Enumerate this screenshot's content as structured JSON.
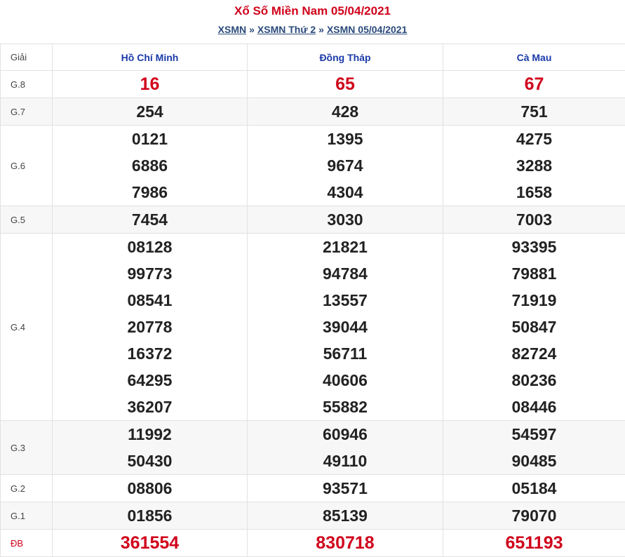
{
  "header": {
    "title": "Xổ Số Miền Nam 05/04/2021",
    "crumbs": [
      "XSMN",
      "XSMN Thứ 2",
      "XSMN 05/04/2021"
    ],
    "sep": "»"
  },
  "table": {
    "giai_header": "Giải",
    "provinces": [
      "Hồ Chí Minh",
      "Đồng Tháp",
      "Cà Mau"
    ],
    "rows": [
      {
        "label": "G.8",
        "red": true,
        "alt": false,
        "cols": [
          [
            "16"
          ],
          [
            "65"
          ],
          [
            "67"
          ]
        ]
      },
      {
        "label": "G.7",
        "red": false,
        "alt": true,
        "cols": [
          [
            "254"
          ],
          [
            "428"
          ],
          [
            "751"
          ]
        ]
      },
      {
        "label": "G.6",
        "red": false,
        "alt": false,
        "cols": [
          [
            "0121",
            "6886",
            "7986"
          ],
          [
            "1395",
            "9674",
            "4304"
          ],
          [
            "4275",
            "3288",
            "1658"
          ]
        ]
      },
      {
        "label": "G.5",
        "red": false,
        "alt": true,
        "cols": [
          [
            "7454"
          ],
          [
            "3030"
          ],
          [
            "7003"
          ]
        ]
      },
      {
        "label": "G.4",
        "red": false,
        "alt": false,
        "cols": [
          [
            "08128",
            "99773",
            "08541",
            "20778",
            "16372",
            "64295",
            "36207"
          ],
          [
            "21821",
            "94784",
            "13557",
            "39044",
            "56711",
            "40606",
            "55882"
          ],
          [
            "93395",
            "79881",
            "71919",
            "50847",
            "82724",
            "80236",
            "08446"
          ]
        ]
      },
      {
        "label": "G.3",
        "red": false,
        "alt": true,
        "cols": [
          [
            "11992",
            "50430"
          ],
          [
            "60946",
            "49110"
          ],
          [
            "54597",
            "90485"
          ]
        ]
      },
      {
        "label": "G.2",
        "red": false,
        "alt": false,
        "cols": [
          [
            "08806"
          ],
          [
            "93571"
          ],
          [
            "05184"
          ]
        ]
      },
      {
        "label": "G.1",
        "red": false,
        "alt": true,
        "cols": [
          [
            "01856"
          ],
          [
            "85139"
          ],
          [
            "79070"
          ]
        ]
      },
      {
        "label": "ĐB",
        "red": true,
        "alt": false,
        "db": true,
        "cols": [
          [
            "361554"
          ],
          [
            "830718"
          ],
          [
            "651193"
          ]
        ]
      }
    ]
  },
  "colors": {
    "red": "#d0021b",
    "blue": "#1a3aa8",
    "link": "#2a4a7b"
  }
}
